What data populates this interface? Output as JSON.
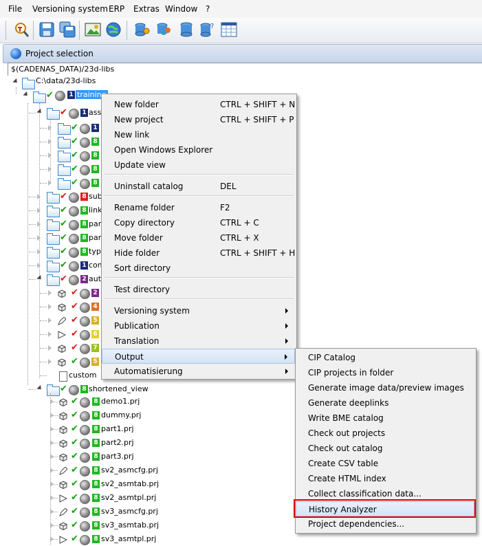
{
  "menubar": {
    "items": [
      "File",
      "Versioning system",
      "ERP",
      "Extras",
      "Window",
      "?"
    ]
  },
  "panel": {
    "title": "Project selection",
    "path": "$(CADENAS_DATA)/23d-libs"
  },
  "tree": {
    "root": "C:\\data/23d-libs",
    "training": "training",
    "children": [
      {
        "label": "ass",
        "badge": "1",
        "color": "#1a2d73",
        "check": "r"
      },
      {
        "label": "",
        "badge": "1",
        "color": "#1a2d73",
        "check": "g"
      },
      {
        "label": "",
        "badge": "8",
        "color": "#1fb81f",
        "check": "g"
      },
      {
        "label": "",
        "badge": "8",
        "color": "#1fb81f",
        "check": "g"
      },
      {
        "label": "",
        "badge": "8",
        "color": "#1fb81f",
        "check": "g"
      },
      {
        "label": "",
        "badge": "8",
        "color": "#1fb81f",
        "check": "g"
      },
      {
        "label": "sub",
        "badge": "8",
        "color": "#e02020",
        "check": "r"
      },
      {
        "label": "links",
        "badge": "8",
        "color": "#1fb81f",
        "check": "g"
      },
      {
        "label": "par",
        "badge": "8",
        "color": "#1fb81f",
        "check": "g"
      },
      {
        "label": "par",
        "badge": "8",
        "color": "#1fb81f",
        "check": "g"
      },
      {
        "label": "typ",
        "badge": "8",
        "color": "#1fb81f",
        "check": "g"
      },
      {
        "label": "com",
        "badge": "1",
        "color": "#1a2d73",
        "check": "g"
      },
      {
        "label": "aut",
        "badge": "2",
        "color": "#7a2a8a",
        "check": "r"
      },
      {
        "label": "",
        "badge": "2",
        "color": "#7a2a8a",
        "check": "r"
      },
      {
        "label": "",
        "badge": "4",
        "color": "#e07020",
        "check": "r"
      },
      {
        "label": "",
        "badge": "5",
        "color": "#d8b020",
        "check": "r"
      },
      {
        "label": "",
        "badge": "6",
        "color": "#e6d020",
        "check": "r"
      },
      {
        "label": "",
        "badge": "7",
        "color": "#9ac020",
        "check": "r"
      },
      {
        "label": "",
        "badge": "5",
        "color": "#d8b020",
        "check": "g"
      },
      {
        "label": "custom"
      }
    ],
    "shortened": "shortened_view",
    "files": [
      "demo1.prj",
      "dummy.prj",
      "part1.prj",
      "part2.prj",
      "part3.prj",
      "sv2_asmcfg.prj",
      "sv2_asmtab.prj",
      "sv2_asmtpl.prj",
      "sv3_asmcfg.prj",
      "sv3_asmtab.prj",
      "sv3_asmtpl.prj"
    ]
  },
  "context_menu": {
    "items": [
      {
        "label": "New folder",
        "shortcut": "CTRL + SHIFT + N"
      },
      {
        "label": "New project",
        "shortcut": "CTRL + SHIFT + P"
      },
      {
        "label": "New link",
        "shortcut": ""
      },
      {
        "label": "Open Windows Explorer",
        "shortcut": ""
      },
      {
        "label": "Update view",
        "shortcut": ""
      },
      {
        "label": "Uninstall catalog",
        "shortcut": "DEL"
      },
      {
        "label": "Rename folder",
        "shortcut": "F2"
      },
      {
        "label": "Copy directory",
        "shortcut": "CTRL + C"
      },
      {
        "label": "Move folder",
        "shortcut": "CTRL + X"
      },
      {
        "label": "Hide folder",
        "shortcut": "CTRL + SHIFT + H"
      },
      {
        "label": "Sort directory",
        "shortcut": ""
      },
      {
        "label": "Test directory",
        "shortcut": ""
      },
      {
        "label": "Versioning system",
        "shortcut": ""
      },
      {
        "label": "Publication",
        "shortcut": ""
      },
      {
        "label": "Translation",
        "shortcut": ""
      },
      {
        "label": "Output",
        "shortcut": ""
      },
      {
        "label": "Automatisierung",
        "shortcut": ""
      }
    ]
  },
  "submenu": {
    "items": [
      "CIP Catalog",
      "CIP projects in folder",
      "Generate image data/preview images",
      "Generate deeplinks",
      "Write BME catalog",
      "Check out projects",
      "Check out catalog",
      "Create CSV table",
      "Create HTML index",
      "Collect classification data...",
      "History Analyzer",
      "Project dependencies..."
    ],
    "highlighted": "History Analyzer"
  }
}
